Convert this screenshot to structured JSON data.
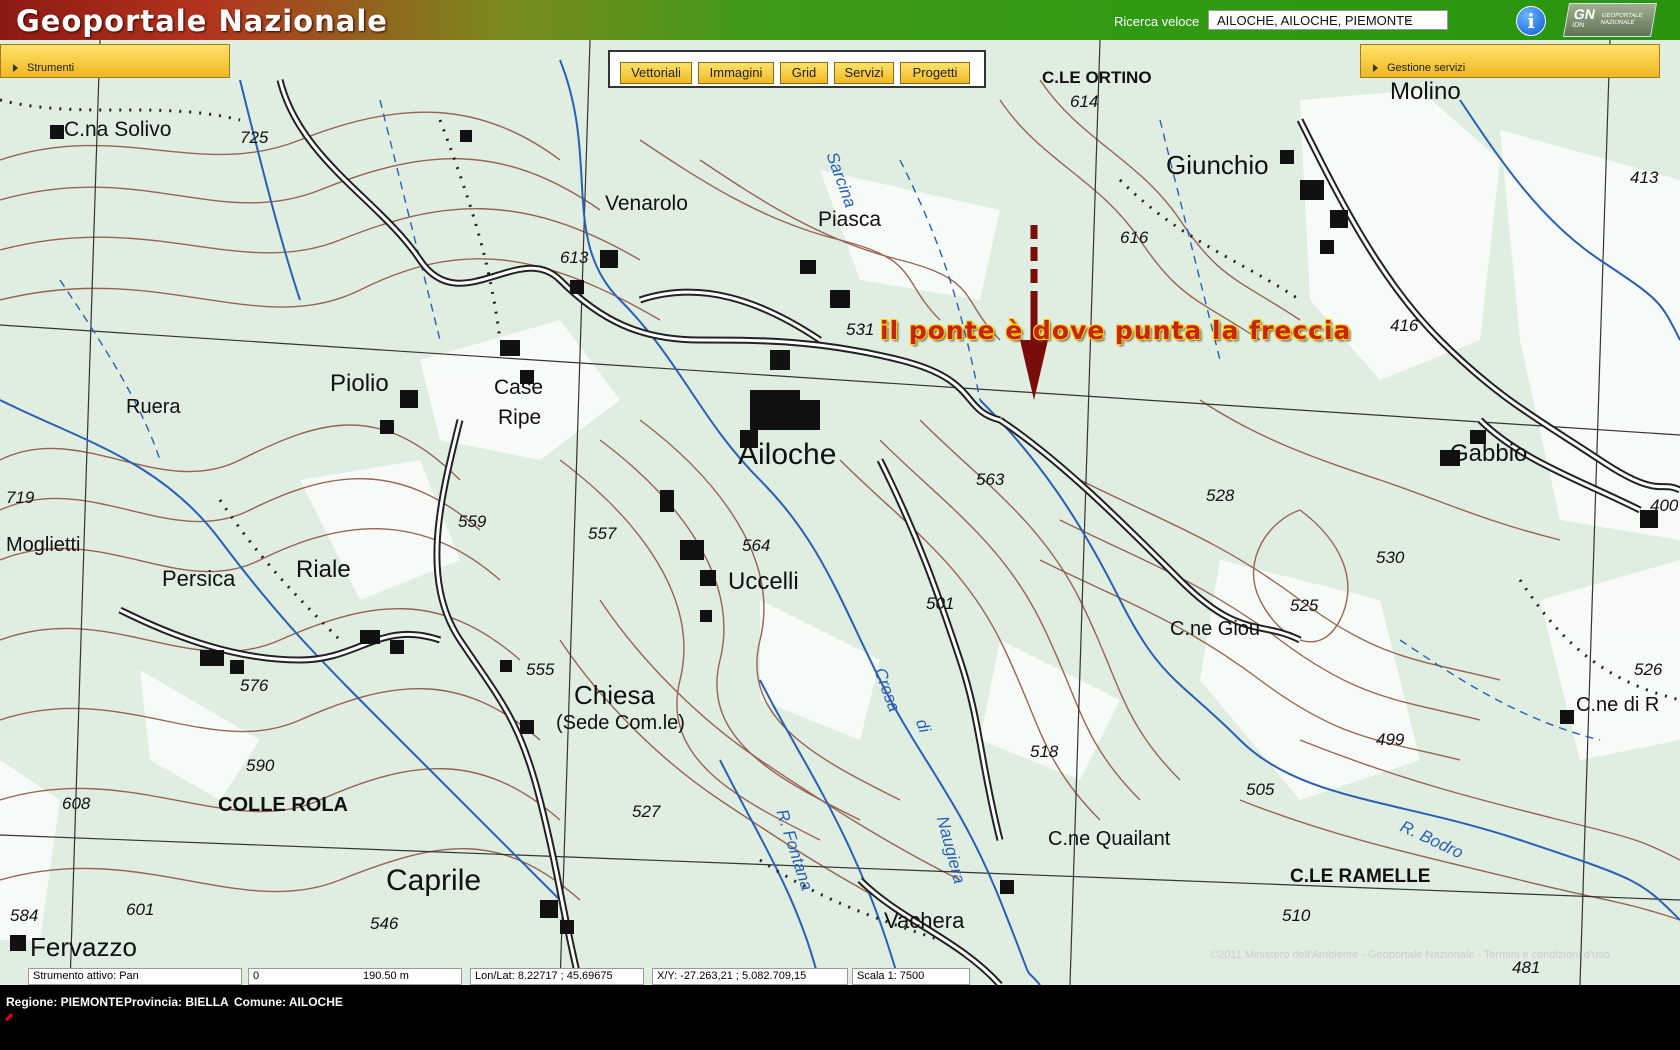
{
  "app": {
    "title": "Geoportale Nazionale"
  },
  "quick_search": {
    "label": "Ricerca veloce",
    "value": "AILOCHE, AILOCHE, PIEMONTE"
  },
  "logo": {
    "gn": "GN",
    "sub": "IDN",
    "text": "GEOPORTALE NAZIONALE"
  },
  "panels": {
    "left": "Strumenti",
    "right": "Gestione servizi"
  },
  "toolbar": {
    "tabs": [
      "Vettoriali",
      "Immagini",
      "Grid",
      "Servizi",
      "Progetti"
    ]
  },
  "map": {
    "annotation": "il ponte è dove punta la freccia",
    "places": {
      "giunchio": "Giunchio",
      "molino": "Molino",
      "c_le_ortino": "C.LE ORTINO",
      "c_na_solivo": "C.na Solivo",
      "venarolo": "Venarolo",
      "piasca": "Piasca",
      "piolio": "Piolio",
      "case": "Case",
      "ripe": "Ripe",
      "ruera": "Ruera",
      "ailoche": "Ailoche",
      "gabbio": "Gabbio",
      "mogliett": "Moglietti",
      "persica": "Persica",
      "riale": "Riale",
      "uccelli": "Uccelli",
      "chiesa": "Chiesa",
      "sede": "(Sede Com.le)",
      "c_ne_giou": "C.ne Giou",
      "c_ne_di_r": "C.ne di R",
      "colle_rola": "COLLE ROLA",
      "caprile": "Caprile",
      "fervazzo": "Fervazzo",
      "vachera": "Vachera",
      "c_ne_quailant": "C.ne Quailant",
      "c_le_ramelle": "C.LE RAMELLE",
      "sarcina": "Sarcina",
      "crosa": "Crosa",
      "di": "di",
      "nauglera": "Naugiera",
      "r_fontana": "R. Fontana",
      "r_bodro": "R. Bodro"
    },
    "spot_heights": [
      "725",
      "614",
      "616",
      "413",
      "613",
      "531",
      "416",
      "563",
      "528",
      "559",
      "557",
      "564",
      "530",
      "525",
      "501",
      "555",
      "576",
      "590",
      "608",
      "527",
      "518",
      "499",
      "505",
      "526",
      "584",
      "601",
      "546",
      "510",
      "481",
      "719",
      "400"
    ],
    "copyright": "©2011 Ministero dell'Ambiente - Geoportale Nazionale - Termini e condizioni d'uso"
  },
  "status": {
    "tool": "Strumento attivo: Pan",
    "scale_zero": "0",
    "scale_dist": "190.50 m",
    "lonlat": "Lon/Lat: 8.22717 ; 45.69675",
    "xy": "X/Y: -27.263,21 ; 5.082.709,15",
    "scale": "Scala 1: 7500"
  },
  "footer": {
    "regione": "Regione: PIEMONTE",
    "provincia": "Provincia: BIELLA",
    "comune": "Comune: AILOCHE"
  },
  "colors": {
    "map_bg": "#dfeee0",
    "contour": "#8b4a3a",
    "river": "#2b5fb5",
    "annotation": "#c4241c",
    "panel": "#f0b722"
  }
}
